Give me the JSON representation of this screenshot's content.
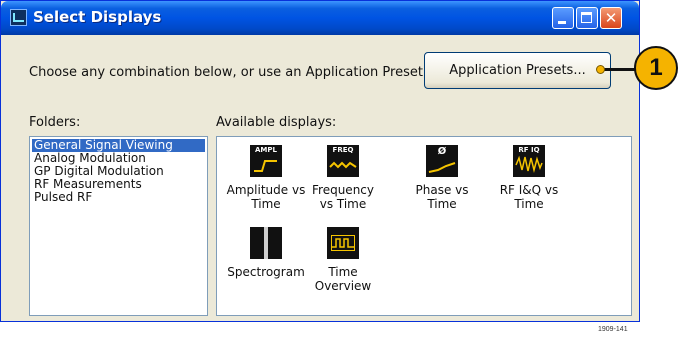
{
  "window": {
    "title": "Select Displays",
    "close_glyph": "✕"
  },
  "instruction": "Choose any combination below, or use an Application Preset.",
  "preset_button": "Application Presets...",
  "folders": {
    "label": "Folders:",
    "items": [
      "General Signal Viewing",
      "Analog Modulation",
      "GP Digital Modulation",
      "RF Measurements",
      "Pulsed RF"
    ],
    "selected": "General Signal Viewing"
  },
  "displays": {
    "label": "Available displays:",
    "items": [
      {
        "tag": "AMPL",
        "line1": "Amplitude vs",
        "line2": "Time",
        "icon": "amplitude-icon"
      },
      {
        "tag": "FREQ",
        "line1": "Frequency",
        "line2": "vs Time",
        "icon": "frequency-icon"
      },
      {
        "tag": "Ø",
        "line1": "Phase vs",
        "line2": "Time",
        "icon": "phase-icon"
      },
      {
        "tag": "RF IQ",
        "line1": "RF I&Q vs",
        "line2": "Time",
        "icon": "rf-iq-icon"
      },
      {
        "tag": "",
        "line1": "Spectrogram",
        "line2": "",
        "icon": "spectrogram-icon"
      },
      {
        "tag": "",
        "line1": "Time",
        "line2": "Overview",
        "icon": "time-overview-icon"
      }
    ]
  },
  "callout": {
    "number": "1"
  },
  "figure_number": "1909-141",
  "colors": {
    "title_bar": "#0054e3",
    "selection": "#316ac5",
    "callout": "#f5b300"
  }
}
